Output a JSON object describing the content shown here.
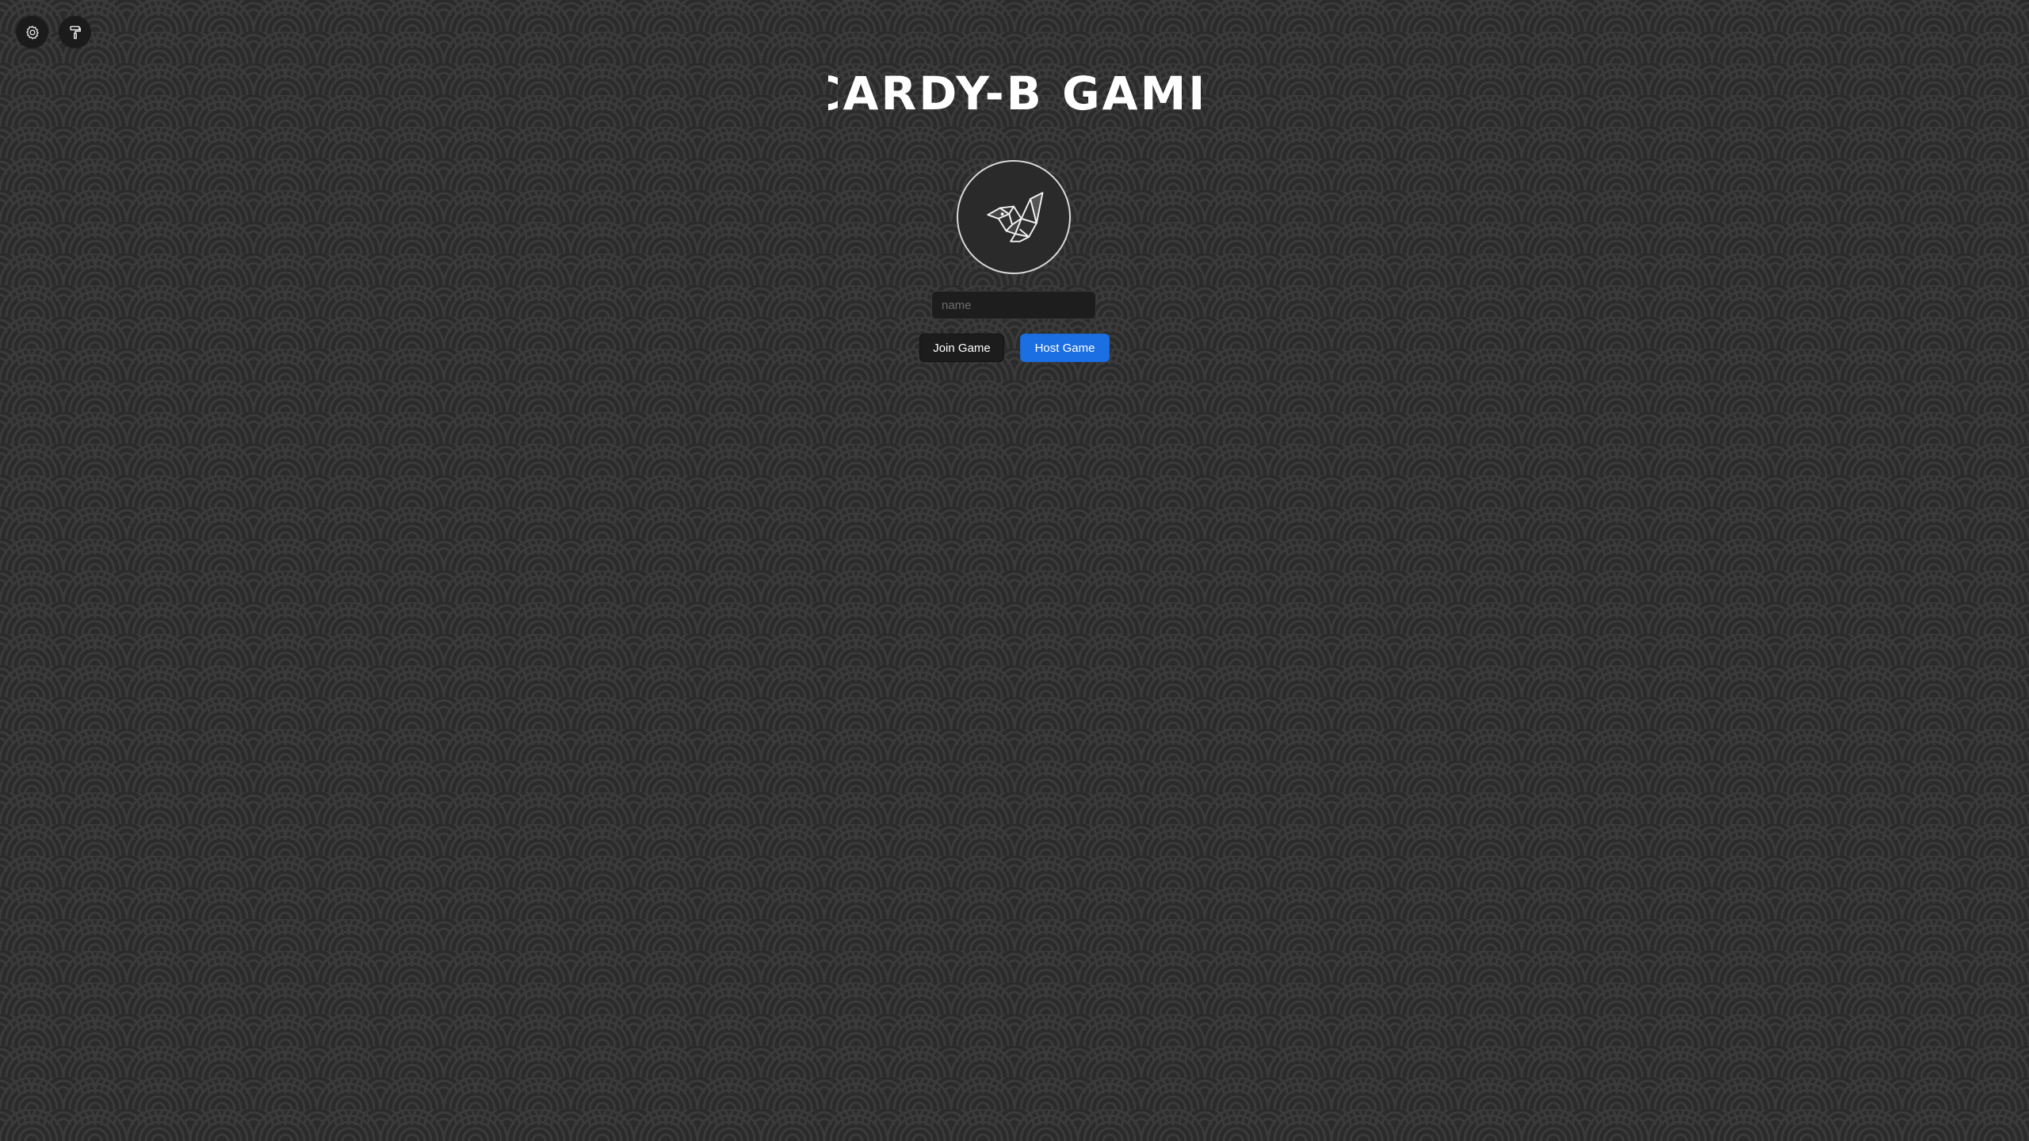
{
  "app": {
    "title": "CARDY-B GAME"
  },
  "toolbar": {
    "settings_icon": "gear-icon",
    "theme_icon": "paint-roller-icon"
  },
  "profile": {
    "avatar_icon": "origami-bird-icon"
  },
  "form": {
    "name_placeholder": "name",
    "name_value": ""
  },
  "actions": {
    "join_label": "Join Game",
    "host_label": "Host Game"
  },
  "colors": {
    "background": "#2b2b2c",
    "pattern_stroke": "#3a3a3b",
    "primary": "#1c6fe3",
    "secondary": "#1c1c1c"
  }
}
